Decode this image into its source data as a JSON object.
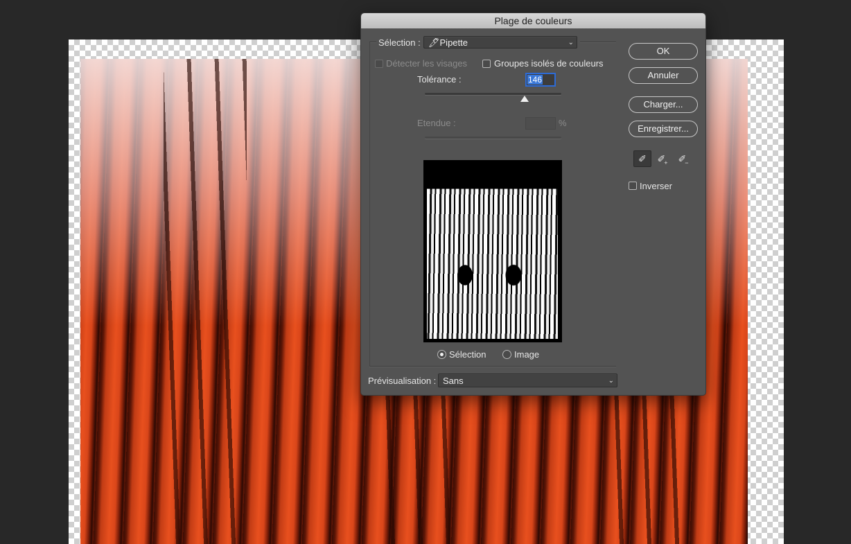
{
  "dialog": {
    "title": "Plage de couleurs",
    "selection_label": "Sélection :",
    "selection_value": "Pipette",
    "selection_icon": "eyedropper-icon",
    "detect_faces_label": "Détecter les visages",
    "localized_clusters_label": "Groupes isolés de couleurs",
    "tolerance_label": "Tolérance :",
    "tolerance_value": "146",
    "tolerance_level": 0.73,
    "range_label": "Etendue :",
    "range_value": "",
    "range_unit": "%",
    "radio_selection_label": "Sélection",
    "radio_image_label": "Image",
    "radio_selected": "Sélection",
    "preview_label": "Prévisualisation :",
    "preview_value": "Sans",
    "buttons": {
      "ok": "OK",
      "cancel": "Annuler",
      "load": "Charger...",
      "save": "Enregistrer..."
    },
    "tools": [
      "eyedropper-icon",
      "eyedropper-plus-icon",
      "eyedropper-minus-icon"
    ],
    "invert_label": "Inverser",
    "invert_checked": false
  },
  "colors": {
    "dialog_bg": "#535353",
    "accent": "#2d6bd6",
    "wood": "#e8501e"
  }
}
